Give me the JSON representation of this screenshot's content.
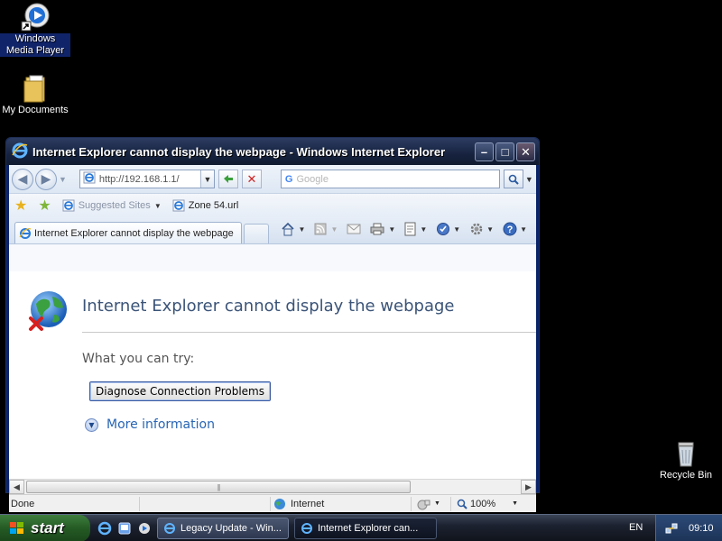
{
  "desktop": {
    "icons": [
      {
        "label": "Windows Media Player"
      },
      {
        "label": "My Documents"
      },
      {
        "label": "Recycle Bin"
      }
    ]
  },
  "window": {
    "title": "Internet Explorer cannot display the webpage - Windows Internet Explorer",
    "address": {
      "url": "http://192.168.1.1/"
    },
    "search": {
      "placeholder": "Google"
    },
    "favorites": {
      "suggested": "Suggested Sites",
      "link": "Zone 54.url"
    },
    "tab": {
      "label": "Internet Explorer cannot display the webpage"
    },
    "content": {
      "title": "Internet Explorer cannot display the webpage",
      "try_text": "What you can try:",
      "diagnose_button": "Diagnose Connection Problems",
      "more_info": "More information"
    },
    "status": {
      "text": "Done",
      "zone": "Internet",
      "zoom": "100%"
    }
  },
  "taskbar": {
    "start_label": "start",
    "tasks": [
      {
        "label": "Legacy Update - Win..."
      },
      {
        "label": "Internet Explorer can..."
      }
    ],
    "language": "EN",
    "clock": "09:10"
  }
}
